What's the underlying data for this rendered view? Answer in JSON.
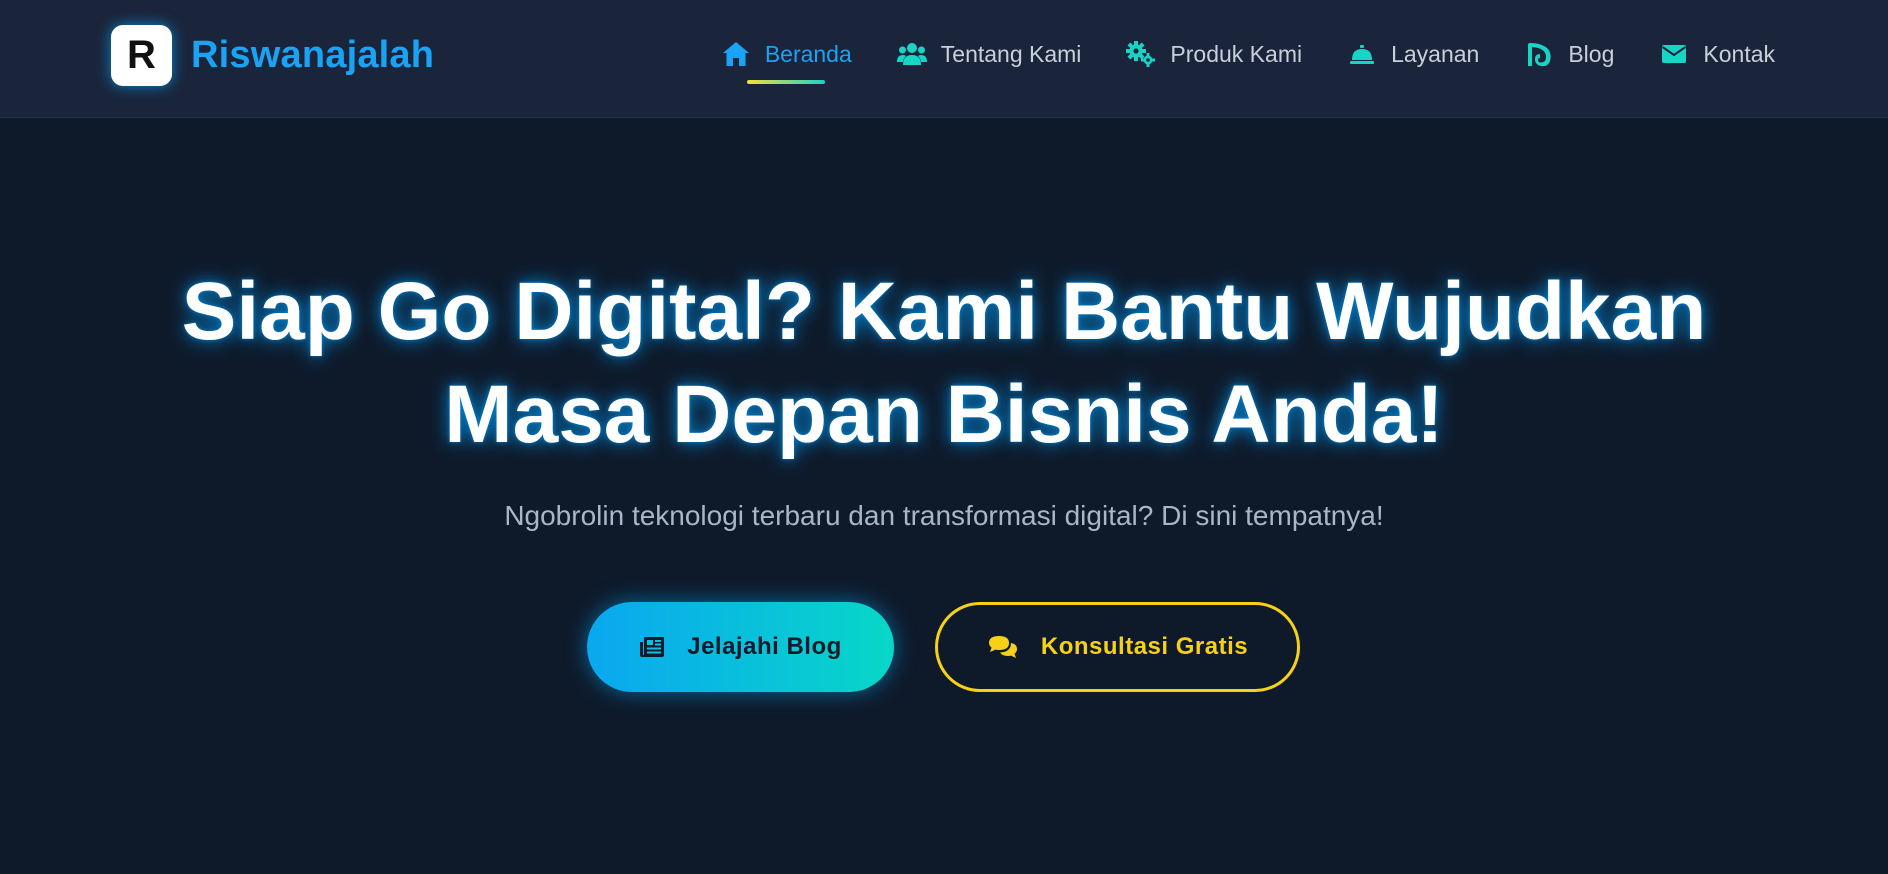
{
  "brand": {
    "logo_letter": "R",
    "name": "Riswanajalah"
  },
  "nav": {
    "items": [
      {
        "label": "Beranda",
        "icon": "home-icon",
        "active": true
      },
      {
        "label": "Tentang Kami",
        "icon": "users-icon",
        "active": false
      },
      {
        "label": "Produk Kami",
        "icon": "gears-icon",
        "active": false
      },
      {
        "label": "Layanan",
        "icon": "concierge-bell-icon",
        "active": false
      },
      {
        "label": "Blog",
        "icon": "blog-icon",
        "active": false
      },
      {
        "label": "Kontak",
        "icon": "envelope-icon",
        "active": false
      }
    ]
  },
  "hero": {
    "title_line1": "Siap Go Digital? Kami Bantu Wujudkan",
    "title_line2": "Masa Depan Bisnis Anda!",
    "subtitle": "Ngobrolin teknologi terbaru dan transformasi digital? Di sini tempatnya!",
    "primary_button": {
      "label": "Jelajahi Blog",
      "icon": "newspaper-icon"
    },
    "secondary_button": {
      "label": "Konsultasi Gratis",
      "icon": "comments-icon"
    }
  },
  "colors": {
    "background": "#0e1a2a",
    "header": "#1a253b",
    "accent_blue": "#1aa3f5",
    "accent_teal": "#19d3c5",
    "accent_yellow": "#f7d117"
  }
}
